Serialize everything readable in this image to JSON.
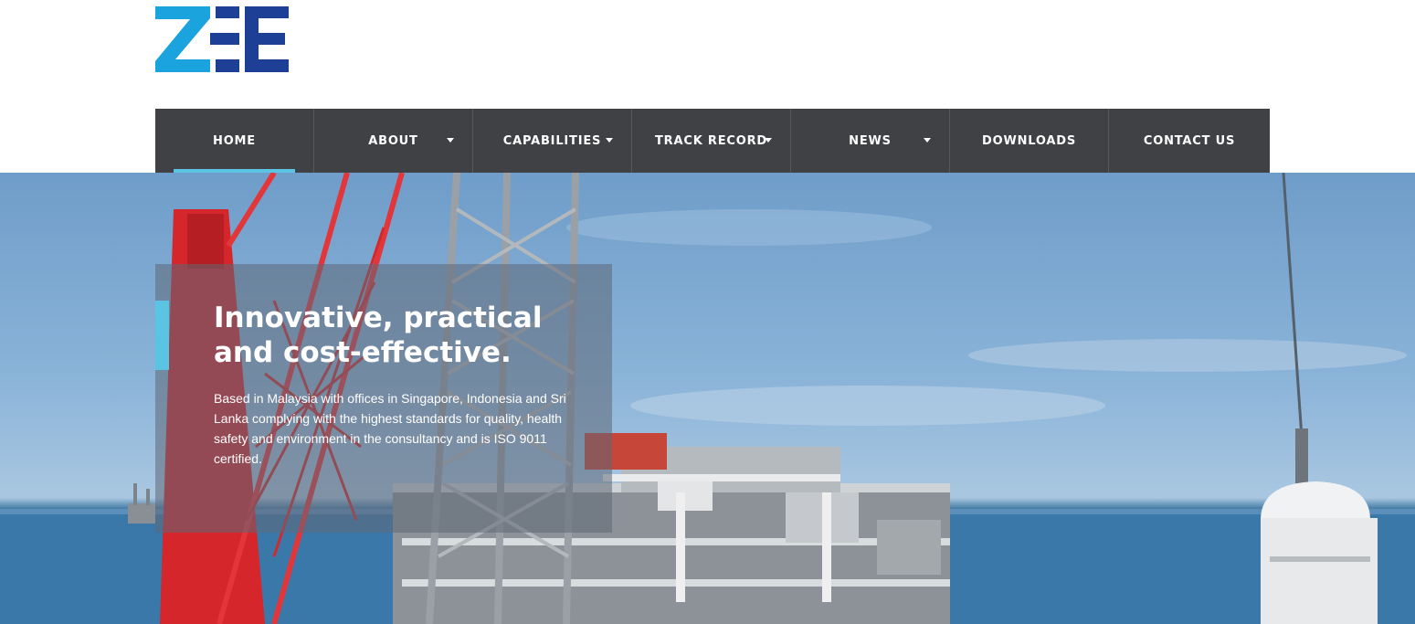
{
  "logo": {
    "text": "ZEE",
    "colors": {
      "light": "#1aa3dd",
      "dark": "#1e3f96"
    }
  },
  "nav": {
    "items": [
      {
        "label": "HOME",
        "active": true,
        "dropdown": false
      },
      {
        "label": "ABOUT",
        "active": false,
        "dropdown": true
      },
      {
        "label": "CAPABILITIES",
        "active": false,
        "dropdown": true
      },
      {
        "label": "TRACK RECORD",
        "active": false,
        "dropdown": true
      },
      {
        "label": "NEWS",
        "active": false,
        "dropdown": true
      },
      {
        "label": "DOWNLOADS",
        "active": false,
        "dropdown": false
      },
      {
        "label": "CONTACT US",
        "active": false,
        "dropdown": false
      }
    ]
  },
  "hero": {
    "title_line1": "Innovative, practical",
    "title_line2": "and cost-effective.",
    "body": "Based in Malaysia with offices in Singapore, Indonesia and Sri Lanka complying with the highest standards for quality, health safety and environment in the consultancy and is ISO 9011 certified."
  },
  "colors": {
    "nav_bg": "#3f4145",
    "accent": "#5bc4e3"
  }
}
